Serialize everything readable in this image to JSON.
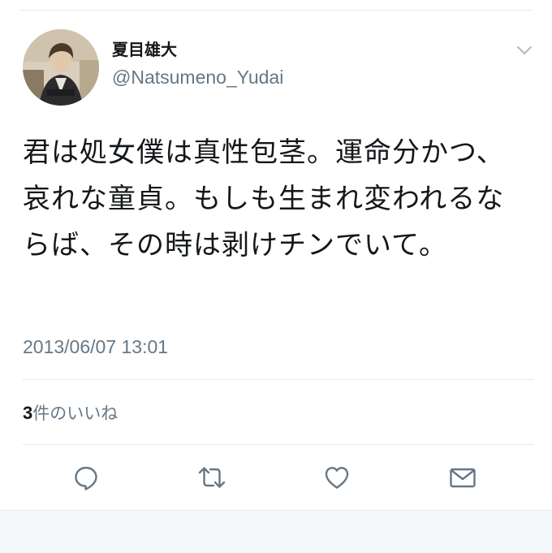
{
  "tweet": {
    "author": {
      "display_name": "夏目雄大",
      "handle": "@Natsumeno_Yudai"
    },
    "text": "君は処女僕は真性包茎。運命分かつ、哀れな童貞。もしも生まれ変われるならば、その時は剥けチンでいて。",
    "timestamp": "2013/06/07 13:01",
    "likes": {
      "count": "3",
      "label": "件のいいね"
    }
  },
  "icons": {
    "caret": "chevron-down-icon",
    "reply": "reply-icon",
    "retweet": "retweet-icon",
    "like": "heart-icon",
    "dm": "envelope-icon"
  },
  "colors": {
    "text": "#14171a",
    "secondary": "#657786",
    "divider": "#e1e8ed",
    "icon": "#657786",
    "background_band": "#f5f8fa"
  }
}
